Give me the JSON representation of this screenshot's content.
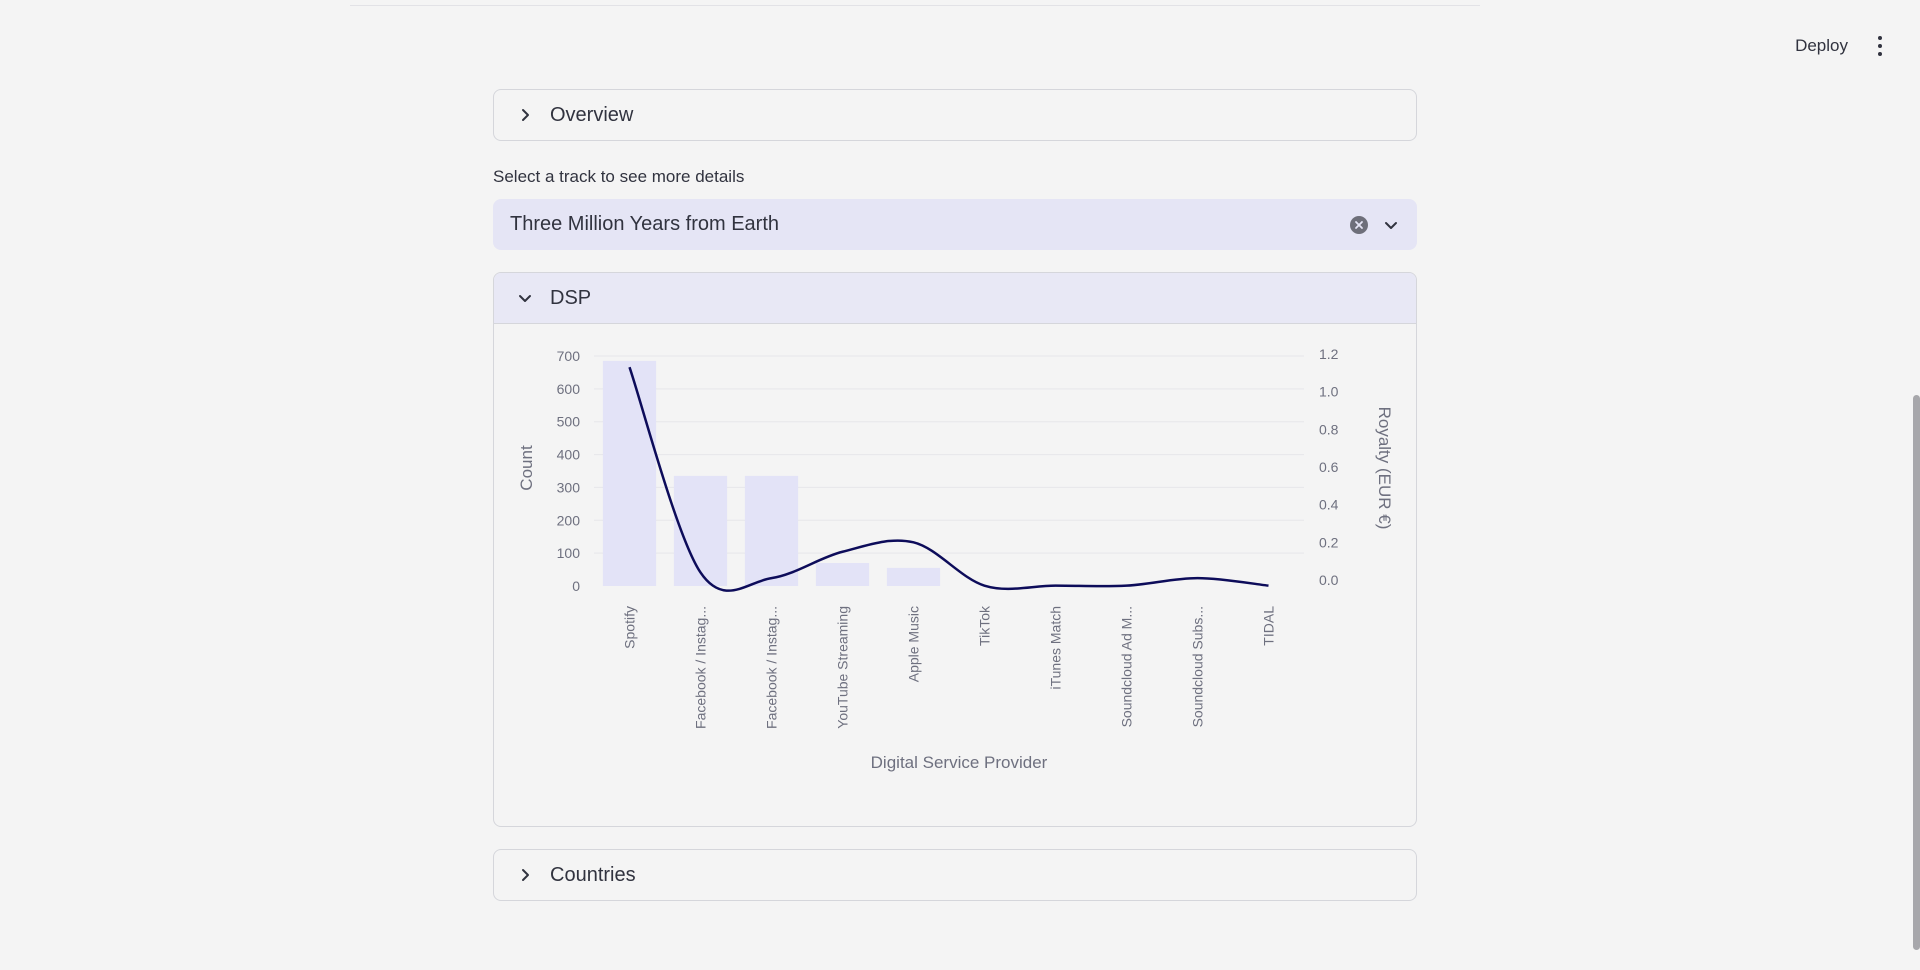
{
  "header": {
    "deploy_label": "Deploy",
    "menu_icon": "more-vertical-icon"
  },
  "overview": {
    "title": "Overview"
  },
  "select": {
    "label": "Select a track to see more details",
    "value": "Three Million Years from Earth"
  },
  "dsp": {
    "title": "DSP"
  },
  "countries": {
    "title": "Countries"
  },
  "colors": {
    "bar": "#e3e3f7",
    "line": "#0d0c5a",
    "select_bg": "#e5e5f5"
  },
  "chart_data": {
    "type": "bar",
    "title": "",
    "xlabel": "Digital Service Provider",
    "ylabel": "Count",
    "y2label": "Royalty (EUR €)",
    "categories": [
      "Spotify",
      "Facebook / Instag...",
      "Facebook / Instag...",
      "YouTube Streaming",
      "Apple Music",
      "TikTok",
      "iTunes Match",
      "Soundcloud Ad M...",
      "Soundcloud Subs...",
      "TIDAL"
    ],
    "ylim": [
      0,
      700
    ],
    "y_ticks": [
      0,
      100,
      200,
      300,
      400,
      500,
      600,
      700
    ],
    "y2lim": [
      0,
      1.2
    ],
    "y2_ticks": [
      0.0,
      0.2,
      0.4,
      0.6,
      0.8,
      1.0,
      1.2
    ],
    "y2_tick_labels": [
      "0.0",
      "0.2",
      "0.4",
      "0.6",
      "0.8",
      "1.0",
      "1.2"
    ],
    "series": [
      {
        "name": "Count",
        "type": "bar",
        "axis": "y",
        "values": [
          685,
          335,
          335,
          70,
          55,
          0,
          0,
          0,
          0,
          0
        ]
      },
      {
        "name": "Royalty",
        "type": "line",
        "axis": "y2",
        "values": [
          1.13,
          0.04,
          0.01,
          0.15,
          0.2,
          -0.03,
          -0.03,
          -0.03,
          0.01,
          -0.03
        ]
      }
    ]
  }
}
